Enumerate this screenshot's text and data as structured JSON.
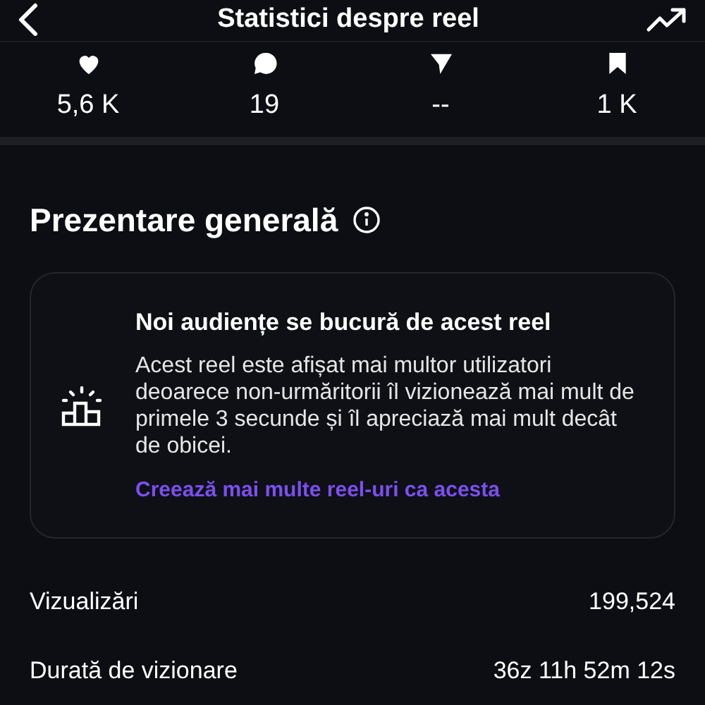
{
  "header": {
    "title": "Statistici despre reel"
  },
  "stats": [
    {
      "kind": "likes",
      "value": "5,6 K"
    },
    {
      "kind": "comments",
      "value": "19"
    },
    {
      "kind": "shares",
      "value": "--"
    },
    {
      "kind": "saves",
      "value": "1 K"
    }
  ],
  "overview": {
    "title": "Prezentare generală",
    "card": {
      "title": "Noi audiențe se bucură de acest reel",
      "text": "Acest reel este afișat mai multor utilizatori deoarece non-urmăritorii îl vizionează mai mult de primele 3 secunde și îl apreciază mai mult decât de obicei.",
      "link": "Creează mai multe reel-uri ca acesta"
    },
    "metrics": [
      {
        "label": "Vizualizări",
        "value": "199,524"
      },
      {
        "label": "Durată de vizionare",
        "value": "36z 11h 52m 12s"
      }
    ]
  }
}
